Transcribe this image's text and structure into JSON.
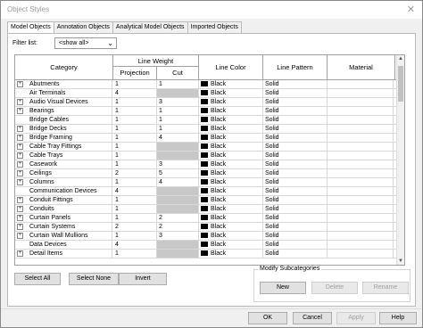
{
  "window": {
    "title": "Object Styles",
    "close_glyph": "✕"
  },
  "tabs": [
    {
      "label": "Model Objects",
      "active": true
    },
    {
      "label": "Annotation Objects",
      "active": false
    },
    {
      "label": "Analytical Model Objects",
      "active": false
    },
    {
      "label": "Imported Objects",
      "active": false
    }
  ],
  "filter": {
    "label": "Filter list:",
    "value": "<show all>"
  },
  "grid": {
    "headers": {
      "category": "Category",
      "line_weight": "Line Weight",
      "projection": "Projection",
      "cut": "Cut",
      "line_color": "Line Color",
      "line_pattern": "Line Pattern",
      "material": "Material"
    },
    "rows": [
      {
        "name": "Abutments",
        "expandable": true,
        "projection": "1",
        "cut": "1",
        "cut_gray": false,
        "color": "Black",
        "pattern": "Solid"
      },
      {
        "name": "Air Terminals",
        "expandable": false,
        "projection": "4",
        "cut": "",
        "cut_gray": true,
        "color": "Black",
        "pattern": "Solid"
      },
      {
        "name": "Audio Visual Devices",
        "expandable": true,
        "projection": "1",
        "cut": "3",
        "cut_gray": false,
        "color": "Black",
        "pattern": "Solid"
      },
      {
        "name": "Bearings",
        "expandable": true,
        "projection": "1",
        "cut": "1",
        "cut_gray": false,
        "color": "Black",
        "pattern": "Solid"
      },
      {
        "name": "Bridge Cables",
        "expandable": false,
        "projection": "1",
        "cut": "1",
        "cut_gray": false,
        "color": "Black",
        "pattern": "Solid"
      },
      {
        "name": "Bridge Decks",
        "expandable": true,
        "projection": "1",
        "cut": "1",
        "cut_gray": false,
        "color": "Black",
        "pattern": "Solid"
      },
      {
        "name": "Bridge Framing",
        "expandable": true,
        "projection": "1",
        "cut": "4",
        "cut_gray": false,
        "color": "Black",
        "pattern": "Solid"
      },
      {
        "name": "Cable Tray Fittings",
        "expandable": true,
        "projection": "1",
        "cut": "",
        "cut_gray": true,
        "color": "Black",
        "pattern": "Solid"
      },
      {
        "name": "Cable Trays",
        "expandable": true,
        "projection": "1",
        "cut": "",
        "cut_gray": true,
        "color": "Black",
        "pattern": "Solid"
      },
      {
        "name": "Casework",
        "expandable": true,
        "projection": "1",
        "cut": "3",
        "cut_gray": false,
        "color": "Black",
        "pattern": "Solid"
      },
      {
        "name": "Ceilings",
        "expandable": true,
        "projection": "2",
        "cut": "5",
        "cut_gray": false,
        "color": "Black",
        "pattern": "Solid"
      },
      {
        "name": "Columns",
        "expandable": true,
        "projection": "1",
        "cut": "4",
        "cut_gray": false,
        "color": "Black",
        "pattern": "Solid"
      },
      {
        "name": "Communication Devices",
        "expandable": false,
        "projection": "4",
        "cut": "",
        "cut_gray": true,
        "color": "Black",
        "pattern": "Solid"
      },
      {
        "name": "Conduit Fittings",
        "expandable": true,
        "projection": "1",
        "cut": "",
        "cut_gray": true,
        "color": "Black",
        "pattern": "Solid"
      },
      {
        "name": "Conduits",
        "expandable": true,
        "projection": "1",
        "cut": "",
        "cut_gray": true,
        "color": "Black",
        "pattern": "Solid"
      },
      {
        "name": "Curtain Panels",
        "expandable": true,
        "projection": "1",
        "cut": "2",
        "cut_gray": false,
        "color": "Black",
        "pattern": "Solid"
      },
      {
        "name": "Curtain Systems",
        "expandable": true,
        "projection": "2",
        "cut": "2",
        "cut_gray": false,
        "color": "Black",
        "pattern": "Solid"
      },
      {
        "name": "Curtain Wall Mullions",
        "expandable": true,
        "projection": "1",
        "cut": "3",
        "cut_gray": false,
        "color": "Black",
        "pattern": "Solid"
      },
      {
        "name": "Data Devices",
        "expandable": false,
        "projection": "4",
        "cut": "",
        "cut_gray": true,
        "color": "Black",
        "pattern": "Solid"
      },
      {
        "name": "Detail Items",
        "expandable": true,
        "projection": "1",
        "cut": "",
        "cut_gray": true,
        "color": "Black",
        "pattern": "Solid"
      }
    ]
  },
  "buttons": {
    "select_all": "Select All",
    "select_none": "Select None",
    "invert": "Invert",
    "modify_group": "Modify Subcategories",
    "new": "New",
    "delete": "Delete",
    "rename": "Rename",
    "ok": "OK",
    "cancel": "Cancel",
    "apply": "Apply",
    "help": "Help"
  },
  "icons": {
    "expand": "plus-box-icon",
    "swatch": "black-color-swatch",
    "scroll": "scrollbar"
  }
}
